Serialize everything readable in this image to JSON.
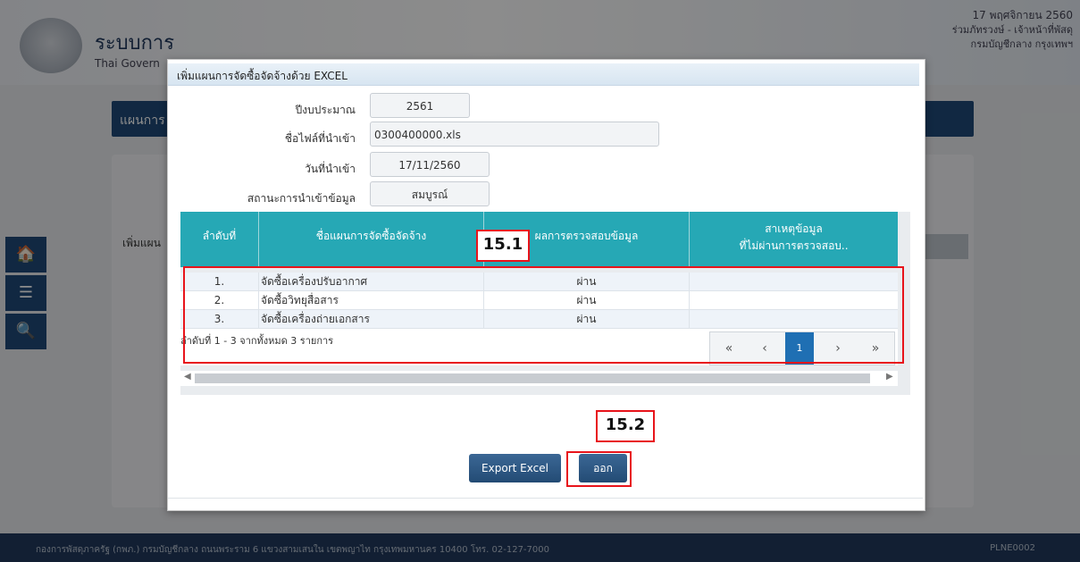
{
  "header": {
    "system_title": "ระบบการ",
    "system_subtitle": "Thai Govern",
    "date": "17 พฤศจิกายน 2560",
    "user": "ร่วมภัทรวงษ์ - เจ้าหน้าที่พัสดุ",
    "department": "กรมบัญชีกลาง กรุงเทพฯ"
  },
  "background": {
    "section_title": "แผนการ",
    "panel_label": "เพิ่มแผน"
  },
  "sidebar": {
    "items": [
      {
        "icon": "home-icon",
        "glyph": "🏠"
      },
      {
        "icon": "menu-icon",
        "glyph": "☰"
      },
      {
        "icon": "search-icon",
        "glyph": "🔍"
      }
    ]
  },
  "modal": {
    "title": "เพิ่มแผนการจัดซื้อจัดจ้างด้วย EXCEL",
    "fields": {
      "budget_year_label": "ปีงบประมาณ",
      "budget_year": "2561",
      "filename_label": "ชื่อไฟล์ที่นำเข้า",
      "filename": "0300400000.xls",
      "import_date_label": "วันที่นำเข้า",
      "import_date": "17/11/2560",
      "status_label": "สถานะการนำเข้าข้อมูล",
      "status": "สมบูรณ์"
    },
    "table": {
      "headers": [
        "ลำดับที่",
        "ชื่อแผนการจัดซื้อจัดจ้าง",
        "ผลการตรวจสอบข้อมูล",
        "สาเหตุข้อมูล",
        "ที่ไม่ผ่านการตรวจสอบ.."
      ],
      "rows": [
        {
          "no": "1.",
          "name": "จัดซื้อเครื่องปรับอากาศ",
          "result": "ผ่าน",
          "reason": ""
        },
        {
          "no": "2.",
          "name": "จัดซื้อวิทยุสื่อสาร",
          "result": "ผ่าน",
          "reason": ""
        },
        {
          "no": "3.",
          "name": "จัดซื้อเครื่องถ่ายเอกสาร",
          "result": "ผ่าน",
          "reason": ""
        }
      ],
      "pager_info": "ลำดับที่ 1 - 3 จากทั้งหมด 3 รายการ",
      "pager": {
        "first": "«",
        "prev": "‹",
        "current": "1",
        "next": "›",
        "last": "»"
      }
    },
    "buttons": {
      "export": "Export Excel",
      "exit": "ออก"
    }
  },
  "annotations": {
    "callout_1": "15.1",
    "callout_2": "15.2"
  },
  "footer": {
    "address": "กองการพัสดุภาครัฐ (กพภ.) กรมบัญชีกลาง ถนนพระราม 6 แขวงสามเสนใน เขตพญาไท กรุงเทพมหานคร 10400 โทร. 02-127-7000",
    "code": "PLNE0002"
  },
  "colors": {
    "navy": "#1f4a78",
    "teal_header": "#26a8b5",
    "annotation_red": "#e8141b"
  }
}
